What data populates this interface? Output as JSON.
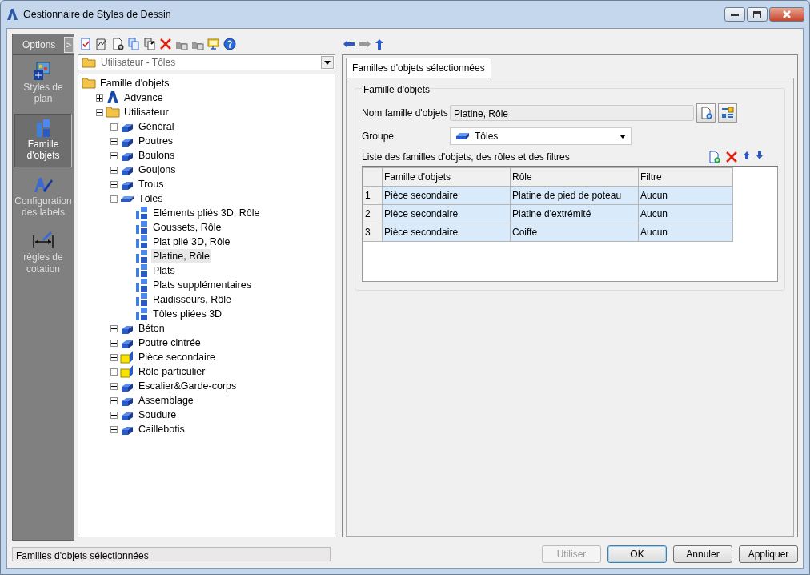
{
  "window": {
    "title": "Gestionnaire de Styles de Dessin"
  },
  "sidebar": {
    "header": "Options",
    "toggle": ">",
    "items": [
      {
        "label": "Styles de plan",
        "kind": "plan",
        "selected": false
      },
      {
        "label": "Famille d'objets",
        "kind": "family",
        "selected": true
      },
      {
        "label": "Configuration des labels",
        "kind": "labels",
        "selected": false
      },
      {
        "label": "règles de cotation",
        "kind": "dimension",
        "selected": false
      }
    ]
  },
  "style_selector": {
    "value": "Utilisateur - Tôles"
  },
  "tree": [
    {
      "label": "Famille d'objets",
      "kind": "folder",
      "selected": false,
      "children": [
        {
          "label": "Advance",
          "kind": "logo",
          "expanded": false,
          "selected": false
        },
        {
          "label": "Utilisateur",
          "kind": "folder",
          "expanded": true,
          "selected": false,
          "children": [
            {
              "label": "Général",
              "kind": "category",
              "expanded": false,
              "selected": false
            },
            {
              "label": "Poutres",
              "kind": "category",
              "expanded": false,
              "selected": false
            },
            {
              "label": "Boulons",
              "kind": "category",
              "expanded": false,
              "selected": false
            },
            {
              "label": "Goujons",
              "kind": "category",
              "expanded": false,
              "selected": false
            },
            {
              "label": "Trous",
              "kind": "category",
              "expanded": false,
              "selected": false
            },
            {
              "label": "Tôles",
              "kind": "plate",
              "expanded": true,
              "selected": false,
              "children": [
                {
                  "label": "Eléments pliés 3D, Rôle",
                  "kind": "family",
                  "selected": false
                },
                {
                  "label": "Goussets, Rôle",
                  "kind": "family",
                  "selected": false
                },
                {
                  "label": "Plat plié 3D, Rôle",
                  "kind": "family",
                  "selected": false
                },
                {
                  "label": "Platine, Rôle",
                  "kind": "family",
                  "selected": true
                },
                {
                  "label": "Plats",
                  "kind": "family",
                  "selected": false
                },
                {
                  "label": "Plats supplémentaires",
                  "kind": "family",
                  "selected": false
                },
                {
                  "label": "Raidisseurs, Rôle",
                  "kind": "family",
                  "selected": false
                },
                {
                  "label": "Tôles pliées 3D",
                  "kind": "family",
                  "selected": false
                }
              ]
            },
            {
              "label": "Béton",
              "kind": "category",
              "expanded": false,
              "selected": false
            },
            {
              "label": "Poutre cintrée",
              "kind": "category",
              "expanded": false,
              "selected": false
            },
            {
              "label": "Pièce secondaire",
              "kind": "part",
              "expanded": false,
              "selected": false
            },
            {
              "label": "Rôle particulier",
              "kind": "part",
              "expanded": false,
              "selected": false
            },
            {
              "label": "Escalier&Garde-corps",
              "kind": "category",
              "expanded": false,
              "selected": false
            },
            {
              "label": "Assemblage",
              "kind": "category",
              "expanded": false,
              "selected": false
            },
            {
              "label": "Soudure",
              "kind": "category",
              "expanded": false,
              "selected": false
            },
            {
              "label": "Caillebotis",
              "kind": "category",
              "expanded": false,
              "selected": false
            }
          ]
        }
      ]
    }
  ],
  "tabs": [
    {
      "label": "Familles d'objets sélectionnées",
      "selected": true
    }
  ],
  "group_box": {
    "title": "Famille d'objets",
    "name_label": "Nom famille d'objets",
    "name_value": "Platine, Rôle",
    "group_label": "Groupe",
    "group_value": "Tôles",
    "list_label": "Liste des familles d'objets, des rôles et des filtres"
  },
  "table": {
    "columns": [
      "Famille d'objets",
      "Rôle",
      "Filtre"
    ],
    "rows": [
      {
        "index": "1",
        "cells": [
          "Pièce secondaire",
          "Platine de pied de poteau",
          "Aucun"
        ]
      },
      {
        "index": "2",
        "cells": [
          "Pièce secondaire",
          "Platine d'extrémité",
          "Aucun"
        ]
      },
      {
        "index": "3",
        "cells": [
          "Pièce secondaire",
          "Coiffe",
          "Aucun"
        ]
      }
    ]
  },
  "status_bar": "Familles d'objets sélectionnées",
  "buttons": [
    {
      "label": "Utiliser",
      "disabled": true
    },
    {
      "label": "OK",
      "disabled": false
    },
    {
      "label": "Annuler",
      "disabled": false
    },
    {
      "label": "Appliquer",
      "disabled": false
    }
  ]
}
